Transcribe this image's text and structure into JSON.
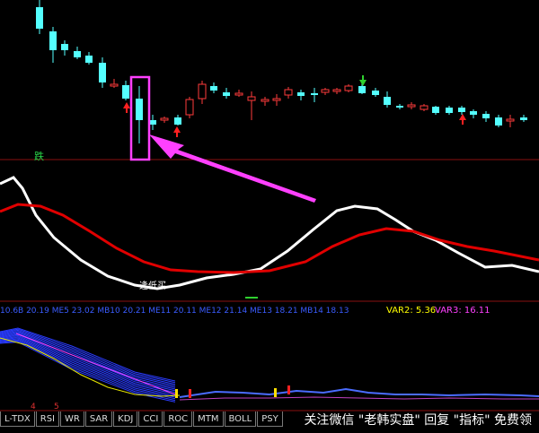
{
  "labels": {
    "fall": "跌",
    "buy_signal": "逢低买",
    "var2": "VAR2: 5.36",
    "var3": "VAR3: 16.11",
    "indicator_values": "10.6B  20.19  ME5  23.02  MB10  20.21  ME11  20.11  ME12  21.14  ME13  18.21  MB14  18.13"
  },
  "tabs": [
    "L-TDX",
    "RSI",
    "WR",
    "SAR",
    "KDJ",
    "CCI",
    "ROC",
    "MTM",
    "BOLL",
    "PSY"
  ],
  "tab_markers": [
    "4",
    "5"
  ],
  "watermark": "关注微信 \"老韩实盘\" 回复 \"指标\" 免费领",
  "colors": {
    "up_candle": "#ff3b3b",
    "down_candle": "#54ffff",
    "white_line": "#ffffff",
    "red_line": "#e00000",
    "highlight_box": "#ff40ff",
    "arrow": "#ff40ff",
    "signal_arrow_green": "#2fd02f",
    "var2": "#ffff00",
    "var3": "#ff40ff"
  },
  "icons": [
    "red-up-arrow-icon",
    "green-down-arrow-icon",
    "magenta-pointer-arrow"
  ]
}
